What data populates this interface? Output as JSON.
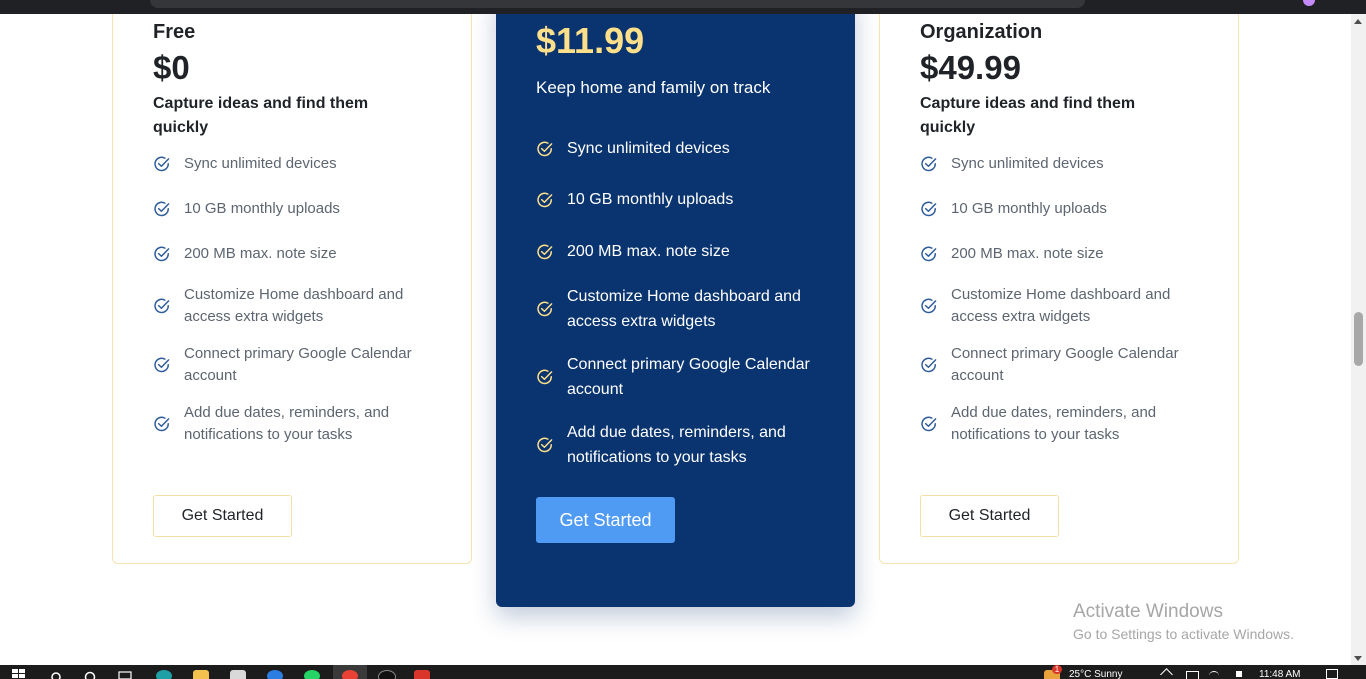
{
  "plans": [
    {
      "name": "Free",
      "price": "$0",
      "tagline": "Capture ideas and find them quickly",
      "features": [
        "Sync unlimited devices",
        "10 GB monthly uploads",
        "200 MB max. note size",
        "Customize Home dashboard and access extra widgets",
        "Connect primary Google Calendar account",
        "Add due dates, reminders, and notifications to your tasks"
      ],
      "cta": "Get Started"
    },
    {
      "name": "",
      "price": "$11.99",
      "tagline": "Keep home and family on track",
      "features": [
        "Sync unlimited devices",
        "10 GB monthly uploads",
        "200 MB max. note size",
        "Customize Home dashboard and access extra widgets",
        "Connect primary Google Calendar account",
        "Add due dates, reminders, and notifications to your tasks"
      ],
      "cta": "Get Started"
    },
    {
      "name": "Organization",
      "price": "$49.99",
      "tagline": "Capture ideas and find them quickly",
      "features": [
        "Sync unlimited devices",
        "10 GB monthly uploads",
        "200 MB max. note size",
        "Customize Home dashboard and access extra widgets",
        "Connect primary Google Calendar account",
        "Add due dates, reminders, and notifications to your tasks"
      ],
      "cta": "Get Started"
    }
  ],
  "watermark": {
    "title": "Activate Windows",
    "subtitle": "Go to Settings to activate Windows."
  },
  "taskbar": {
    "weather": "25°C  Sunny",
    "clock": "11:48 AM",
    "notification_count": "1"
  },
  "colors": {
    "featured_bg": "#0a346f",
    "featured_price": "#ffe08a",
    "accent_blue": "#4f9bf4",
    "card_border": "#f6e3b0",
    "check_side": "#2f5c9a",
    "check_featured": "#ffe08a"
  },
  "icons": {
    "feature_check": "check-circle-icon"
  }
}
